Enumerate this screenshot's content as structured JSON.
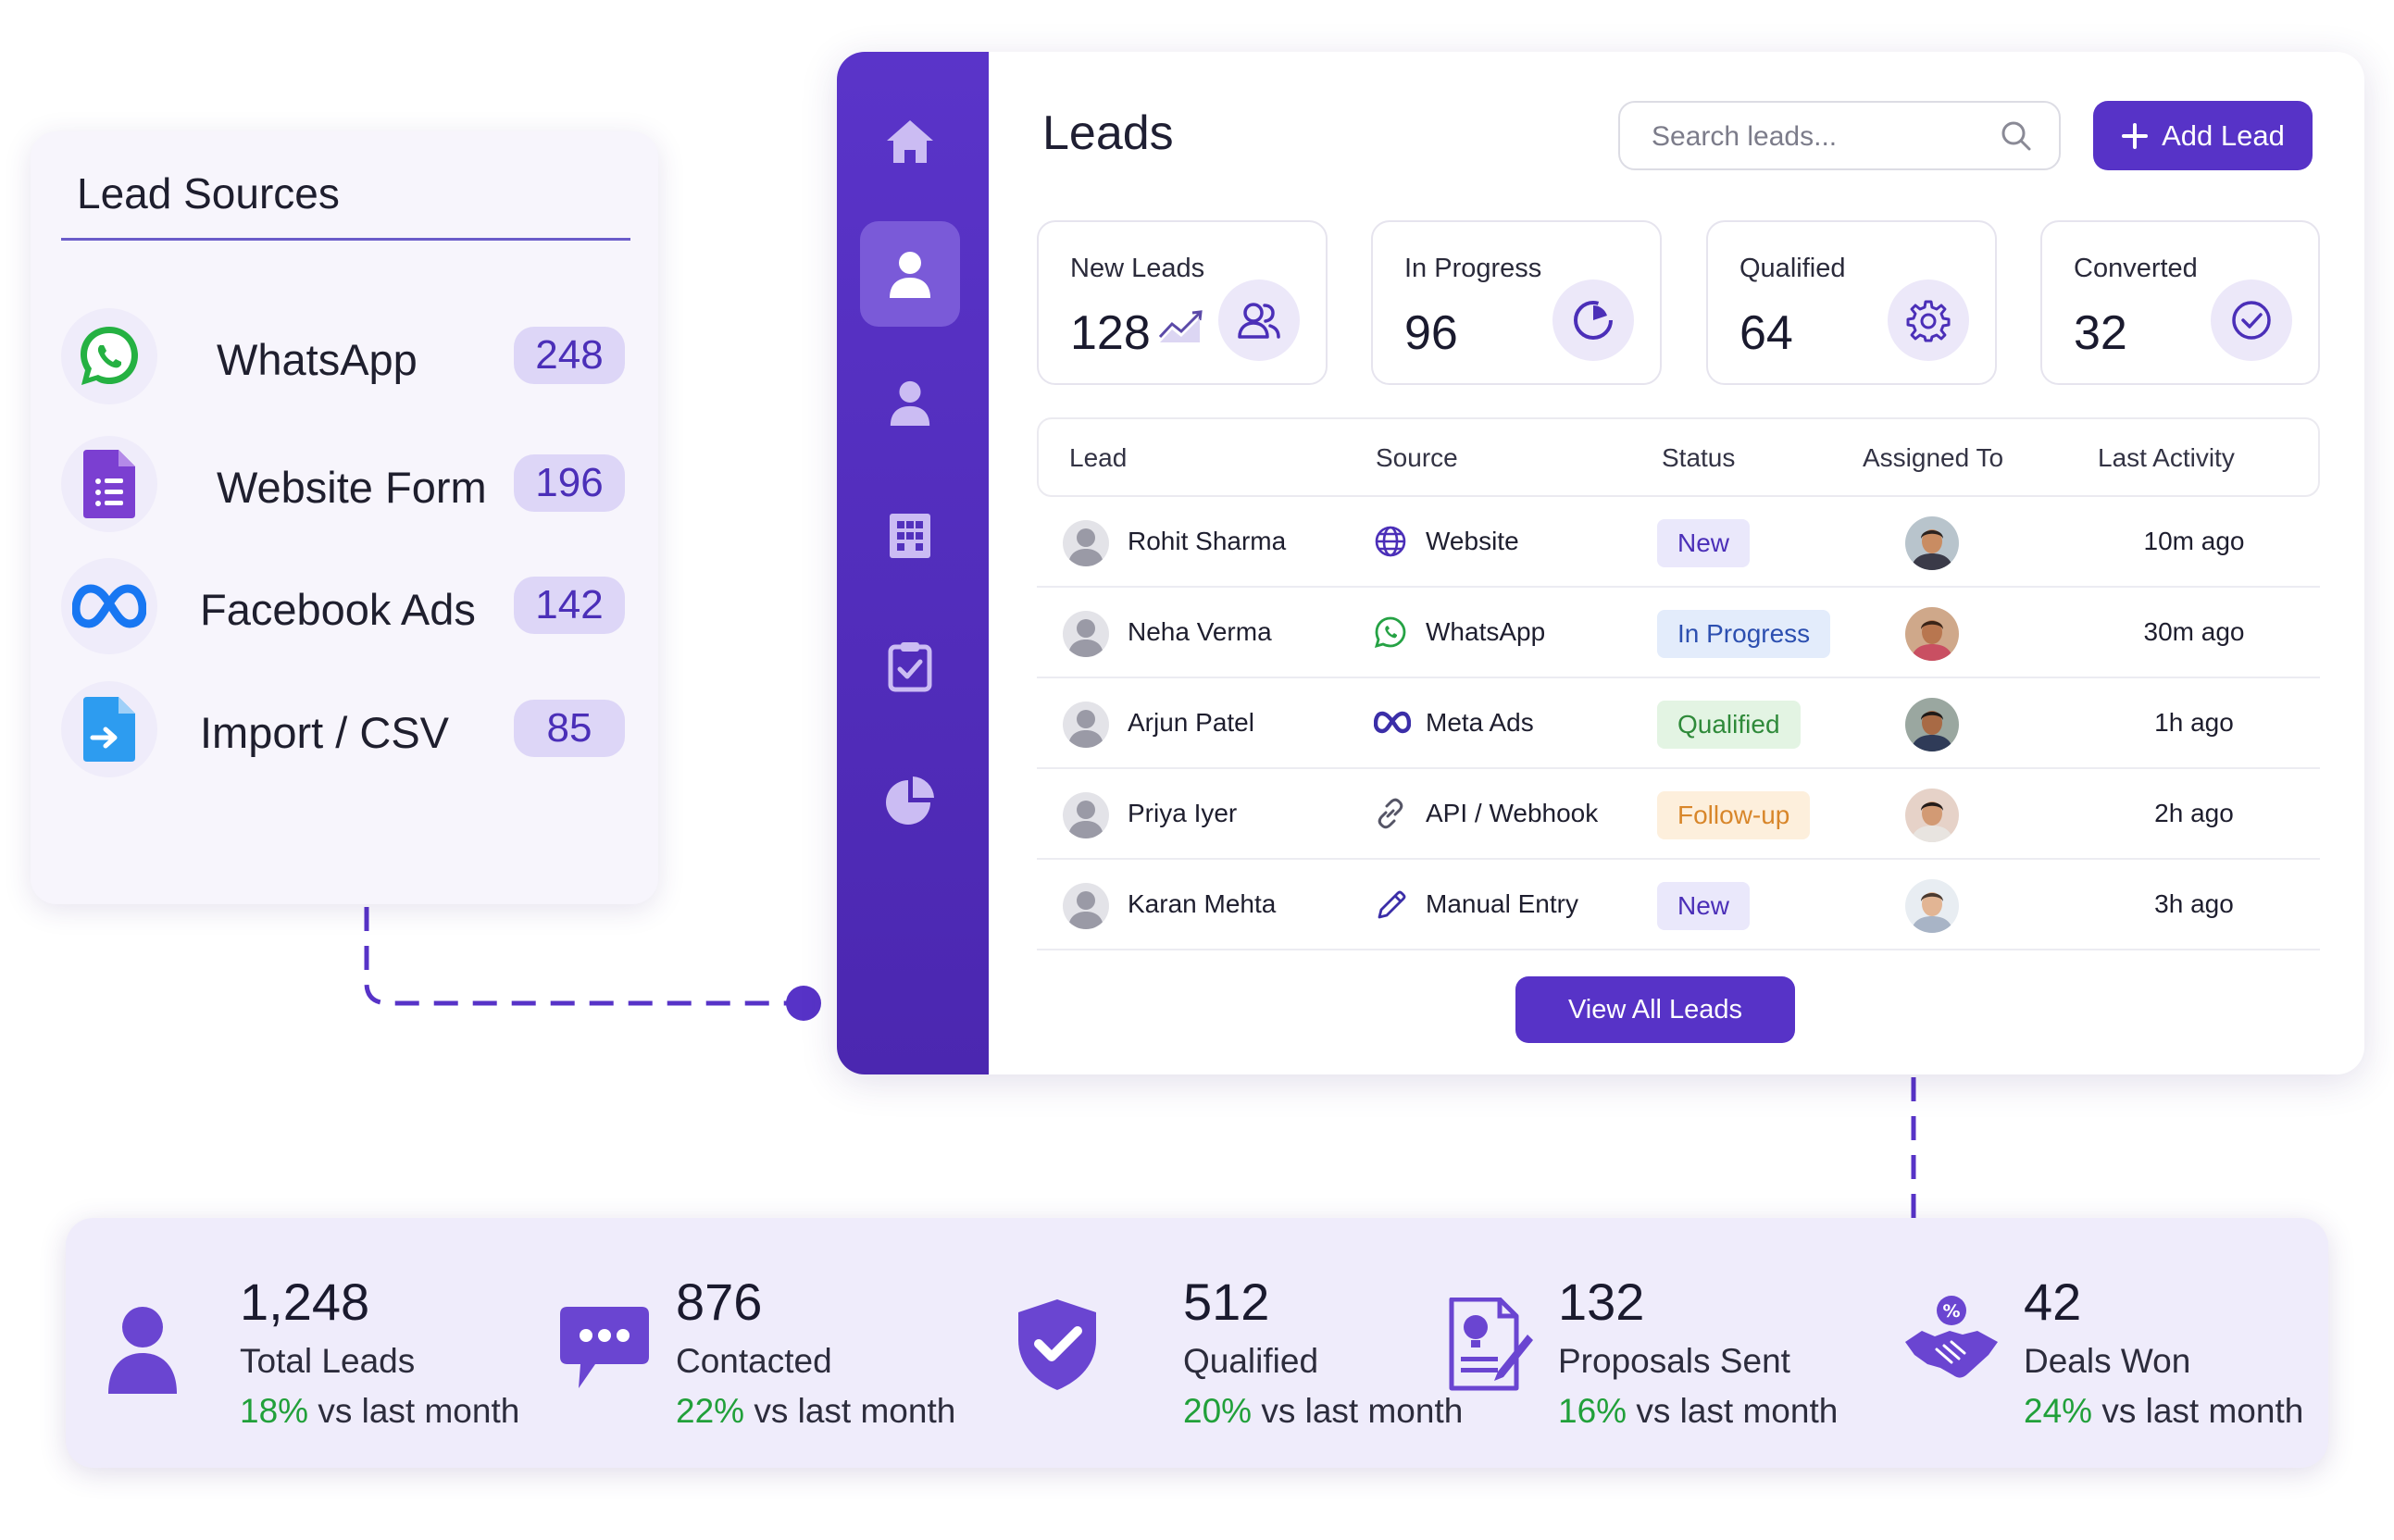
{
  "lead_sources": {
    "title": "Lead Sources",
    "items": [
      {
        "label": "WhatsApp",
        "count": "248",
        "icon": "whatsapp-icon"
      },
      {
        "label": "Website Form",
        "count": "196",
        "icon": "form-icon"
      },
      {
        "label": "Facebook Ads",
        "count": "142",
        "icon": "meta-icon"
      },
      {
        "label": "Import / CSV",
        "count": "85",
        "icon": "import-file-icon"
      }
    ]
  },
  "sidebar": {
    "items": [
      {
        "icon": "home-icon",
        "active": false
      },
      {
        "icon": "user-icon",
        "active": true
      },
      {
        "icon": "contact-icon",
        "active": false
      },
      {
        "icon": "building-icon",
        "active": false
      },
      {
        "icon": "clipboard-check-icon",
        "active": false
      },
      {
        "icon": "pie-chart-icon",
        "active": false
      }
    ]
  },
  "header": {
    "title": "Leads",
    "search_placeholder": "Search leads...",
    "add_button": "Add Lead"
  },
  "stats": [
    {
      "label": "New Leads",
      "value": "128",
      "icon": "users-icon"
    },
    {
      "label": "In Progress",
      "value": "96",
      "icon": "progress-icon"
    },
    {
      "label": "Qualified",
      "value": "64",
      "icon": "gear-icon"
    },
    {
      "label": "Converted",
      "value": "32",
      "icon": "check-circle-icon"
    }
  ],
  "table": {
    "columns": [
      "Lead",
      "Source",
      "Status",
      "Assigned To",
      "Last Activity"
    ],
    "rows": [
      {
        "name": "Rohit Sharma",
        "source": "Website",
        "source_icon": "globe-icon",
        "status": "New",
        "time": "10m ago"
      },
      {
        "name": "Neha Verma",
        "source": "WhatsApp",
        "source_icon": "whatsapp-icon",
        "status": "In Progress",
        "time": "30m ago"
      },
      {
        "name": "Arjun Patel",
        "source": "Meta Ads",
        "source_icon": "meta-icon",
        "status": "Qualified",
        "time": "1h ago"
      },
      {
        "name": "Priya Iyer",
        "source": "API / Webhook",
        "source_icon": "link-icon",
        "status": "Follow-up",
        "time": "2h ago"
      },
      {
        "name": "Karan Mehta",
        "source": "Manual Entry",
        "source_icon": "pencil-icon",
        "status": "New",
        "time": "3h ago"
      }
    ],
    "view_all": "View All Leads"
  },
  "status_colors": {
    "New": {
      "bg": "#eae8fb",
      "fg": "#4b2fb8"
    },
    "In Progress": {
      "bg": "#e3ecfb",
      "fg": "#2c4fb0"
    },
    "Qualified": {
      "bg": "#e3f4e3",
      "fg": "#2f8a3a"
    },
    "Follow-up": {
      "bg": "#fdefdc",
      "fg": "#d8862a"
    }
  },
  "kpis": [
    {
      "value": "1,248",
      "label": "Total Leads",
      "pct": "18%",
      "suffix": "vs last month",
      "icon": "person-icon"
    },
    {
      "value": "876",
      "label": "Contacted",
      "pct": "22%",
      "suffix": "vs last month",
      "icon": "chat-bubble-icon"
    },
    {
      "value": "512",
      "label": "Qualified",
      "pct": "20%",
      "suffix": "vs last month",
      "icon": "shield-check-icon"
    },
    {
      "value": "132",
      "label": "Proposals Sent",
      "pct": "16%",
      "suffix": "vs last month",
      "icon": "proposal-doc-icon"
    },
    {
      "value": "42",
      "label": "Deals Won",
      "pct": "24%",
      "suffix": "vs last month",
      "icon": "handshake-icon"
    }
  ],
  "colors": {
    "brand": "#5733c7",
    "sidebar": "#4f2bb8",
    "positive": "#21a03a"
  }
}
